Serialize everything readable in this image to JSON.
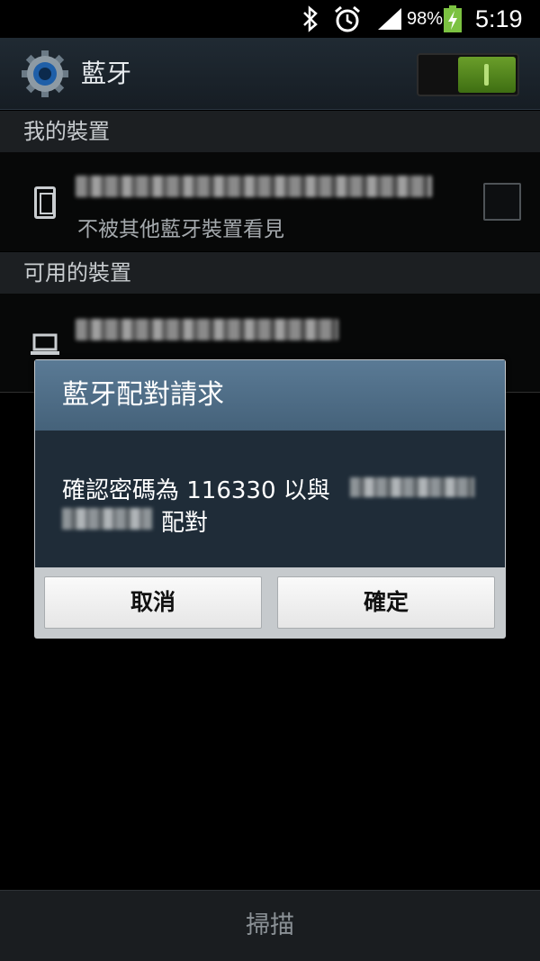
{
  "status_bar": {
    "battery_percent": "98%",
    "time": "5:19",
    "icons": [
      "bluetooth-icon",
      "alarm-icon",
      "signal-icon",
      "battery-charging-icon"
    ]
  },
  "action_bar": {
    "title": "藍牙",
    "icon": "settings-gear-icon",
    "toggle_state": "on"
  },
  "sections": [
    {
      "header": "我的裝置",
      "items": [
        {
          "name": "",
          "subtitle": "不被其他藍牙裝置看見",
          "icon": "phone-icon",
          "checked": false
        }
      ]
    },
    {
      "header": "可用的裝置",
      "items": [
        {
          "name": "",
          "subtitle": "",
          "icon": "laptop-icon"
        }
      ]
    }
  ],
  "dialog": {
    "title": "藍牙配對請求",
    "message_prefix": "確認密碼為 116330 以與",
    "message_suffix": "配對",
    "cancel_label": "取消",
    "ok_label": "確定"
  },
  "bottom_bar": {
    "scan_label": "掃描"
  },
  "colors": {
    "toggle_on": "#4f8a1c",
    "dialog_title_bg": "#4f6e87",
    "dialog_body_bg": "#1f2c38"
  }
}
